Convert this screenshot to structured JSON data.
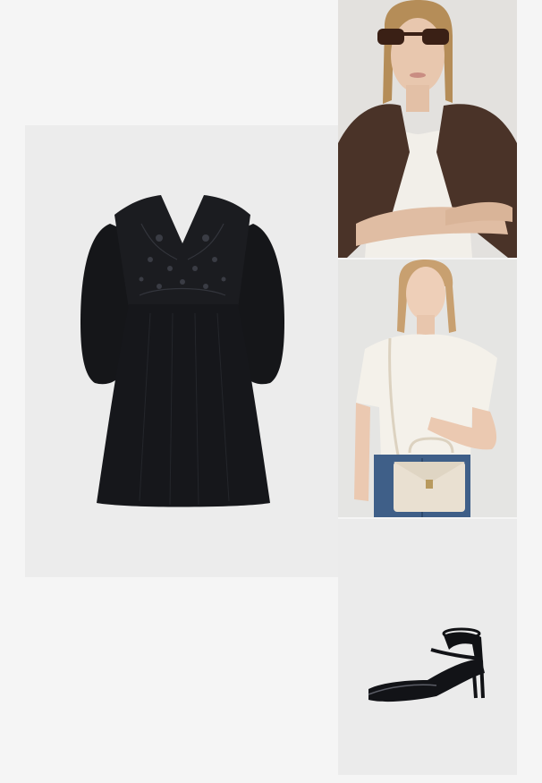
{
  "page": {
    "background": "#f5f5f5"
  },
  "tiles": [
    {
      "name": "product-tile-dress",
      "icon": "black-eyelet-mini-dress",
      "background": "#ececec"
    },
    {
      "name": "product-tile-brown-cardigan",
      "icon": "model-brown-knit-cardigan-sunglasses",
      "background": "#e3e1de"
    },
    {
      "name": "product-tile-white-top",
      "icon": "model-white-top-cream-bag",
      "background": "#e5e5e3"
    },
    {
      "name": "product-tile-black-heels",
      "icon": "black-patent-ankle-strap-heels",
      "background": "#ebebeb"
    }
  ]
}
